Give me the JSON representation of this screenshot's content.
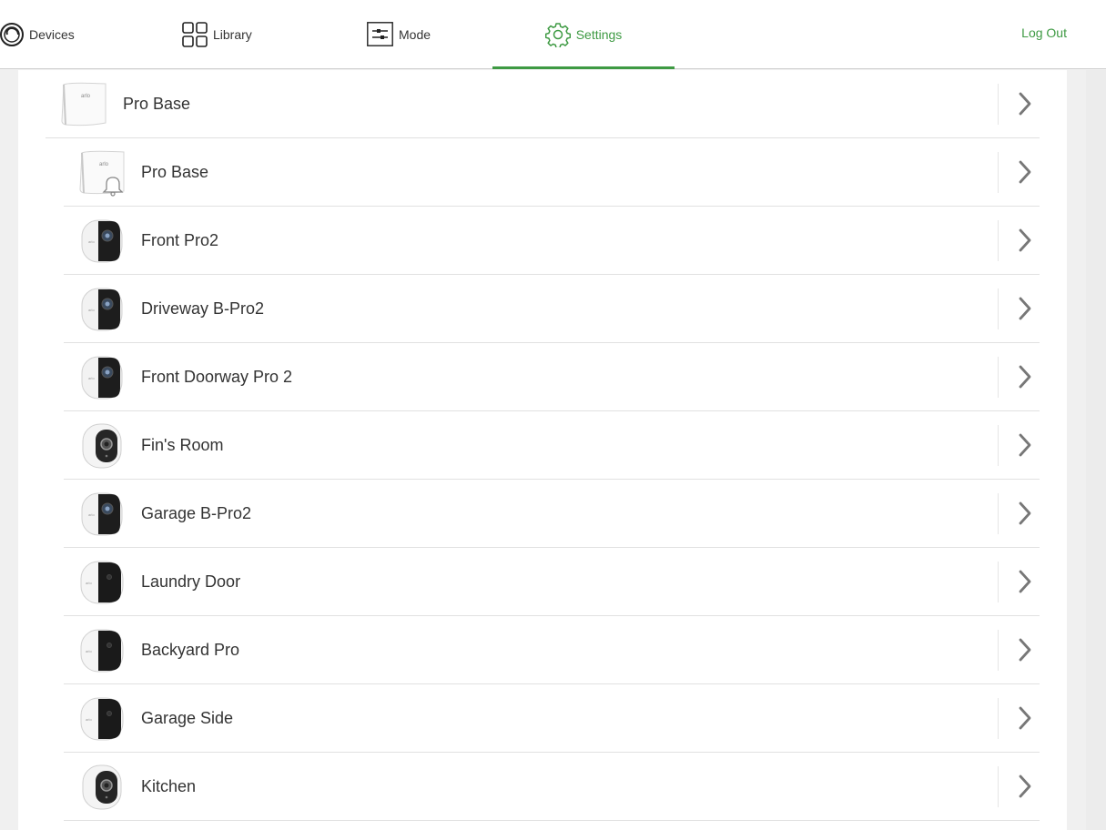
{
  "nav": {
    "devices_label": "Devices",
    "library_label": "Library",
    "mode_label": "Mode",
    "settings_label": "Settings",
    "logout_label": "Log Out",
    "active_color": "#3e9a43"
  },
  "base": {
    "name": "Pro Base",
    "icon": "base-station-icon"
  },
  "devices": [
    {
      "name": "Pro Base",
      "icon": "base-station-siren-icon"
    },
    {
      "name": "Front Pro2",
      "icon": "pro2-camera-icon"
    },
    {
      "name": "Driveway B-Pro2",
      "icon": "pro2-camera-icon"
    },
    {
      "name": "Front Doorway Pro 2",
      "icon": "pro2-camera-icon"
    },
    {
      "name": "Fin's Room",
      "icon": "indoor-camera-icon"
    },
    {
      "name": "Garage B-Pro2",
      "icon": "pro2-camera-icon"
    },
    {
      "name": "Laundry Door",
      "icon": "pro-camera-icon"
    },
    {
      "name": "Backyard Pro",
      "icon": "pro-camera-icon"
    },
    {
      "name": "Garage Side",
      "icon": "pro-camera-icon"
    },
    {
      "name": "Kitchen",
      "icon": "indoor-camera-icon"
    }
  ]
}
